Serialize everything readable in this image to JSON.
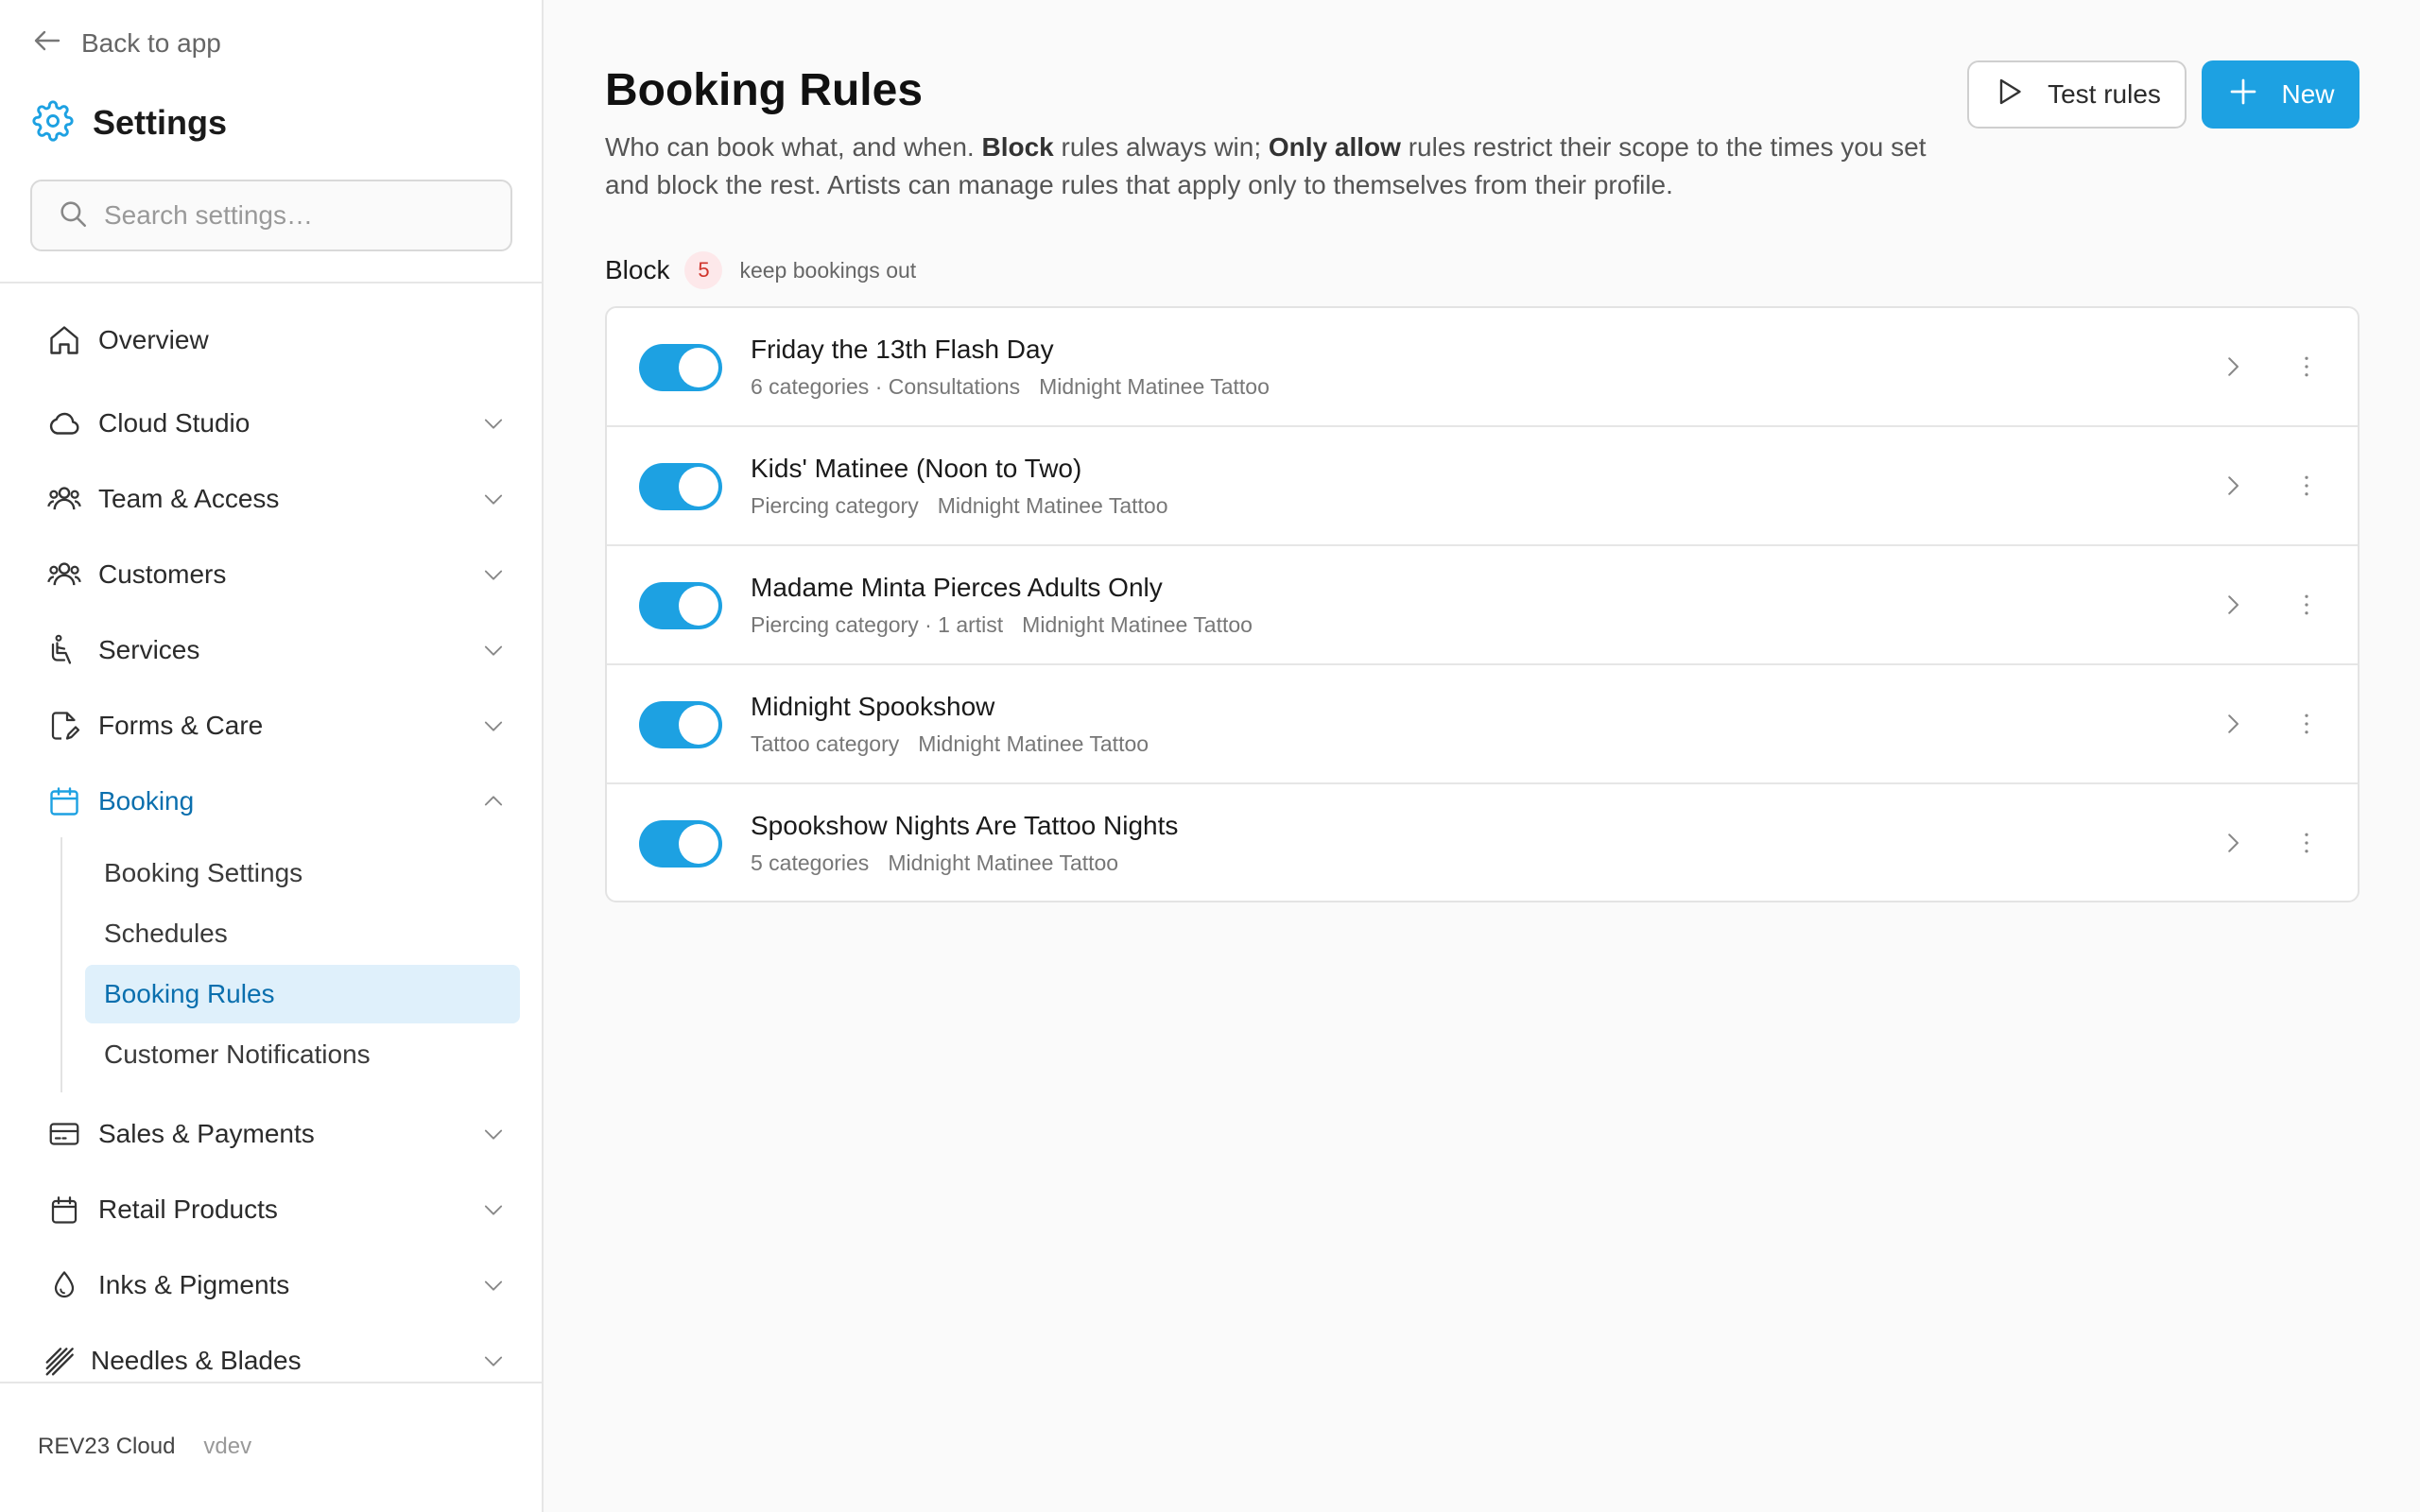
{
  "sidebar": {
    "back_label": "Back to app",
    "title": "Settings",
    "search_placeholder": "Search settings…",
    "nav": {
      "overview": "Overview",
      "cloud_studio": "Cloud Studio",
      "team_access": "Team & Access",
      "customers": "Customers",
      "services": "Services",
      "forms_care": "Forms & Care",
      "booking": "Booking",
      "sales_payments": "Sales & Payments",
      "retail_products": "Retail Products",
      "inks_pigments": "Inks & Pigments",
      "needles_blades": "Needles & Blades"
    },
    "booking_sub": {
      "booking_settings": "Booking Settings",
      "schedules": "Schedules",
      "booking_rules": "Booking Rules",
      "customer_notifications": "Customer Notifications"
    },
    "footer": {
      "brand": "REV23 Cloud",
      "version": "vdev"
    }
  },
  "main": {
    "title": "Booking Rules",
    "desc": {
      "p1": "Who can book what, and when. ",
      "b1": "Block",
      "p2": " rules always win; ",
      "b2": "Only allow",
      "p3": " rules restrict their scope to the times you set and block the rest. Artists can manage rules that apply only to themselves from their profile."
    },
    "test_button": "Test rules",
    "new_button": "New",
    "group": {
      "title": "Block",
      "count": "5",
      "desc": "keep bookings out"
    },
    "rules": [
      {
        "name": "Friday the 13th Flash Day",
        "scope": "6 categories · Consultations",
        "location": "Midnight Matinee Tattoo",
        "enabled": true
      },
      {
        "name": "Kids' Matinee (Noon to Two)",
        "scope": "Piercing category",
        "location": "Midnight Matinee Tattoo",
        "enabled": true
      },
      {
        "name": "Madame Minta Pierces Adults Only",
        "scope": "Piercing category · 1 artist",
        "location": "Midnight Matinee Tattoo",
        "enabled": true
      },
      {
        "name": "Midnight Spookshow",
        "scope": "Tattoo category",
        "location": "Midnight Matinee Tattoo",
        "enabled": true
      },
      {
        "name": "Spookshow Nights Are Tattoo Nights",
        "scope": "5 categories",
        "location": "Midnight Matinee Tattoo",
        "enabled": true
      }
    ]
  },
  "colors": {
    "accent": "#1da1e2",
    "active_text": "#0a6fae",
    "active_bg": "#dff0fb",
    "badge_bg": "#fde8ea",
    "badge_text": "#d0342c"
  }
}
